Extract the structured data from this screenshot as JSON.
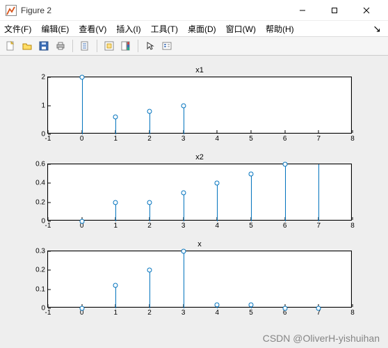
{
  "window": {
    "title": "Figure 2",
    "min_tip": "Minimize",
    "max_tip": "Restore",
    "close_tip": "Close"
  },
  "menu": {
    "file": "文件(F)",
    "edit": "编辑(E)",
    "view": "查看(V)",
    "insert": "插入(I)",
    "tools": "工具(T)",
    "desktop": "桌面(D)",
    "window": "窗口(W)",
    "help": "帮助(H)",
    "right_glyph": "↘"
  },
  "toolbar": {
    "new": "新建",
    "open": "打开",
    "save": "保存",
    "print": "打印",
    "link": "链接",
    "datacursor": "数据提示",
    "colorbar": "颜色栏",
    "arrow": "编辑",
    "legend": "图例"
  },
  "watermark": "CSDN @OliverH-yishuihan",
  "chart_data": [
    {
      "type": "stem",
      "title": "x1",
      "xlabel": "",
      "ylabel": "",
      "xlim": [
        -1,
        8
      ],
      "ylim": [
        0,
        2
      ],
      "xticks": [
        -1,
        0,
        1,
        2,
        3,
        4,
        5,
        6,
        7,
        8
      ],
      "yticks": [
        0,
        1,
        2
      ],
      "x": [
        0,
        1,
        2,
        3
      ],
      "y": [
        2.0,
        0.6,
        0.8,
        1.0
      ]
    },
    {
      "type": "stem",
      "title": "x2",
      "xlabel": "",
      "ylabel": "",
      "xlim": [
        -1,
        8
      ],
      "ylim": [
        0,
        0.6
      ],
      "xticks": [
        -1,
        0,
        1,
        2,
        3,
        4,
        5,
        6,
        7,
        8
      ],
      "yticks": [
        0,
        0.2,
        0.4,
        0.6
      ],
      "x": [
        0,
        1,
        2,
        3,
        4,
        5,
        6,
        7
      ],
      "y": [
        0.0,
        0.2,
        0.2,
        0.3,
        0.4,
        0.5,
        0.6,
        0.7
      ]
    },
    {
      "type": "stem",
      "title": "x",
      "xlabel": "",
      "ylabel": "",
      "xlim": [
        -1,
        8
      ],
      "ylim": [
        0,
        0.3
      ],
      "xticks": [
        -1,
        0,
        1,
        2,
        3,
        4,
        5,
        6,
        7,
        8
      ],
      "yticks": [
        0,
        0.1,
        0.2,
        0.3
      ],
      "x": [
        0,
        1,
        2,
        3,
        4,
        5,
        6,
        7
      ],
      "y": [
        0.0,
        0.12,
        0.2,
        0.3,
        0.02,
        0.02,
        0.0,
        0.0
      ]
    }
  ]
}
